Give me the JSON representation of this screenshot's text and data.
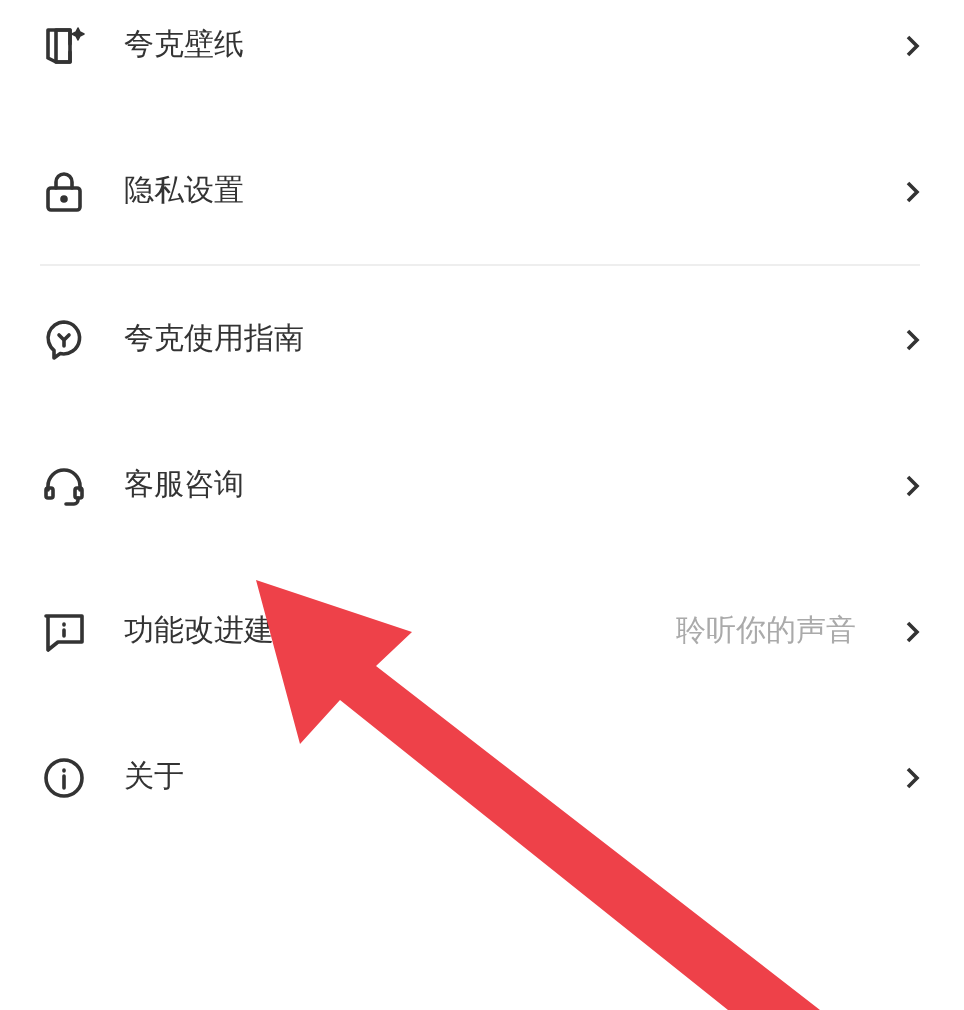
{
  "groups": [
    {
      "items": [
        {
          "label": "夸克壁纸"
        },
        {
          "label": "隐私设置"
        }
      ]
    },
    {
      "items": [
        {
          "label": "夸克使用指南"
        },
        {
          "label": "客服咨询"
        },
        {
          "label": "功能改进建",
          "hint": "聆听你的声音"
        },
        {
          "label": "关于"
        }
      ]
    }
  ]
}
